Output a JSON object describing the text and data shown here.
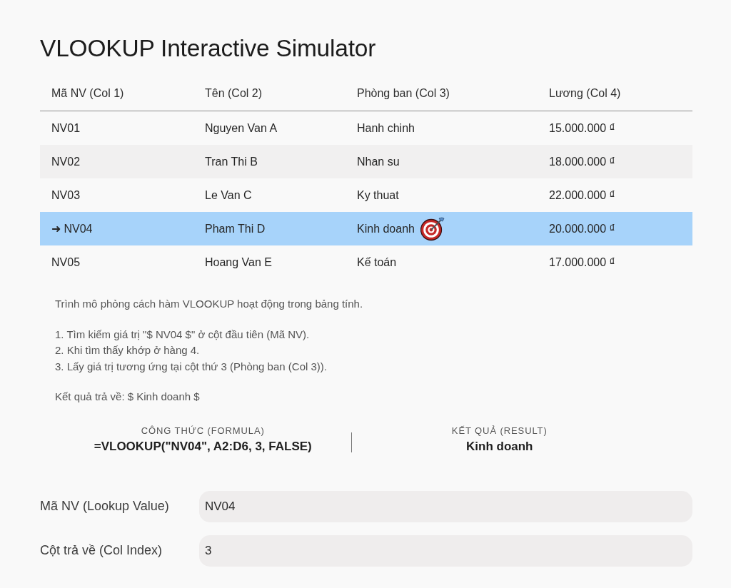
{
  "title": "VLOOKUP Interactive Simulator",
  "table": {
    "columns": [
      "Mã NV (Col 1)",
      "Tên (Col 2)",
      "Phòng ban (Col 3)",
      "Lương (Col 4)"
    ],
    "rows": [
      {
        "selected": false,
        "cells": [
          {
            "text": "NV01",
            "target": false
          },
          {
            "text": "Nguyen Van A",
            "target": false
          },
          {
            "text": "Hanh chinh",
            "target": false
          },
          {
            "text": "15.000.000 ₫",
            "target": false
          }
        ]
      },
      {
        "selected": false,
        "cells": [
          {
            "text": "NV02",
            "target": false
          },
          {
            "text": "Tran Thi B",
            "target": false
          },
          {
            "text": "Nhan su",
            "target": false
          },
          {
            "text": "18.000.000 ₫",
            "target": false
          }
        ]
      },
      {
        "selected": false,
        "cells": [
          {
            "text": "NV03",
            "target": false
          },
          {
            "text": "Le Van C",
            "target": false
          },
          {
            "text": "Ky thuat",
            "target": false
          },
          {
            "text": "22.000.000 ₫",
            "target": false
          }
        ]
      },
      {
        "selected": true,
        "cells": [
          {
            "text": "➜ NV04",
            "target": false
          },
          {
            "text": "Pham Thi D",
            "target": false
          },
          {
            "text": "Kinh doanh",
            "target": true
          },
          {
            "text": "20.000.000 ₫",
            "target": false
          }
        ]
      },
      {
        "selected": false,
        "cells": [
          {
            "text": "NV05",
            "target": false
          },
          {
            "text": "Hoang Van E",
            "target": false
          },
          {
            "text": "Kế toán",
            "target": false
          },
          {
            "text": "17.000.000 ₫",
            "target": false
          }
        ]
      }
    ]
  },
  "explanation": {
    "intro": "Trình mô phỏng cách hàm VLOOKUP hoạt động trong bảng tính.",
    "steps": [
      "1. Tìm kiếm giá trị \"$ NV04 $\" ở cột đầu tiên (Mã NV).",
      "2. Khi tìm thấy khớp ở hàng 4.",
      "3. Lấy giá trị tương ứng tại cột thứ 3 (Phòng ban (Col 3))."
    ],
    "result": "Kết quả trả về: $ Kinh doanh $"
  },
  "summary": [
    {
      "label": "CÔNG THỨC (FORMULA)",
      "value": "=VLOOKUP(\"NV04\", A2:D6, 3, FALSE)"
    },
    {
      "label": "KẾT QUẢ (RESULT)",
      "value": "Kinh doanh"
    }
  ],
  "fields": [
    {
      "label": "Mã NV (Lookup Value)",
      "value": "NV04"
    },
    {
      "label": "Cột trả về (Col Index)",
      "value": "3"
    }
  ]
}
